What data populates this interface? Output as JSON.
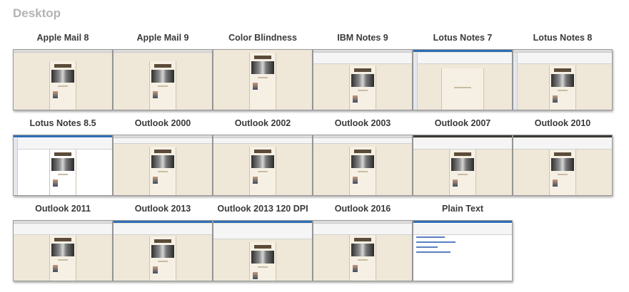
{
  "section": {
    "title": "Desktop"
  },
  "clients": [
    {
      "label": "Apple Mail 8"
    },
    {
      "label": "Apple Mail 9"
    },
    {
      "label": "Color Blindness"
    },
    {
      "label": "IBM Notes 9"
    },
    {
      "label": "Lotus Notes 7"
    },
    {
      "label": "Lotus Notes 8"
    },
    {
      "label": "Lotus Notes 8.5"
    },
    {
      "label": "Outlook 2000"
    },
    {
      "label": "Outlook 2002"
    },
    {
      "label": "Outlook 2003"
    },
    {
      "label": "Outlook 2007"
    },
    {
      "label": "Outlook 2010"
    },
    {
      "label": "Outlook 2011"
    },
    {
      "label": "Outlook 2013"
    },
    {
      "label": "Outlook 2013 120 DPI"
    },
    {
      "label": "Outlook 2016"
    },
    {
      "label": "Plain Text"
    }
  ]
}
